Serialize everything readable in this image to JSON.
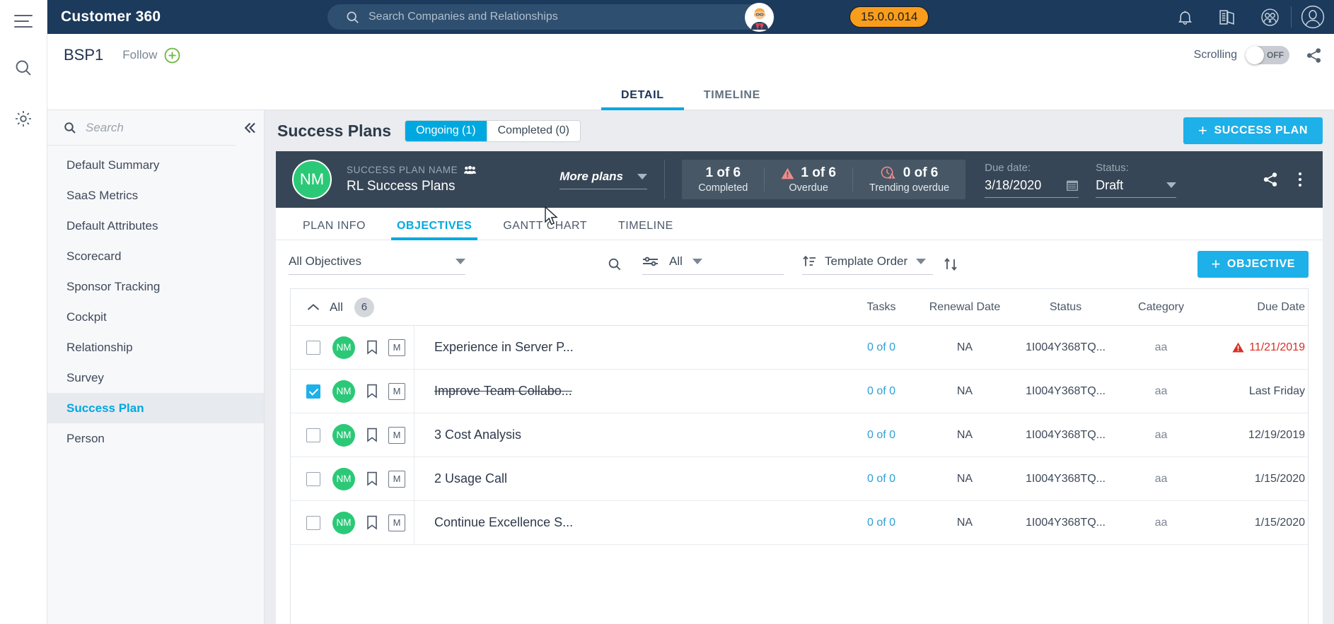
{
  "topbar": {
    "brand": "Customer 360",
    "search_placeholder": "Search Companies and Relationships",
    "version": "15.0.0.014",
    "icons": [
      "bell-icon",
      "book-icon",
      "people-icon",
      "user-avatar-icon"
    ]
  },
  "subheader": {
    "entity": "BSP1",
    "follow_label": "Follow",
    "scrolling_label": "Scrolling",
    "scrolling_state": "OFF"
  },
  "main_tabs": [
    {
      "label": "DETAIL",
      "active": true
    },
    {
      "label": "TIMELINE",
      "active": false
    }
  ],
  "leftnav": {
    "search_placeholder": "Search",
    "search_value": "",
    "items": [
      {
        "label": "Default Summary",
        "active": false
      },
      {
        "label": "SaaS Metrics",
        "active": false
      },
      {
        "label": "Default Attributes",
        "active": false
      },
      {
        "label": "Scorecard",
        "active": false
      },
      {
        "label": "Sponsor Tracking",
        "active": false
      },
      {
        "label": "Cockpit",
        "active": false
      },
      {
        "label": "Relationship",
        "active": false
      },
      {
        "label": "Survey",
        "active": false
      },
      {
        "label": "Success Plan",
        "active": true
      },
      {
        "label": "Person",
        "active": false
      }
    ]
  },
  "success_plans": {
    "title": "Success Plans",
    "segments": [
      {
        "label": "Ongoing (1)",
        "active": true
      },
      {
        "label": "Completed (0)",
        "active": false
      }
    ],
    "add_button": "SUCCESS PLAN"
  },
  "plan_card": {
    "avatar_initials": "NM",
    "name_label": "SUCCESS PLAN NAME",
    "name": "RL Success Plans",
    "more_plans": "More plans",
    "stats": [
      {
        "value": "1 of 6",
        "label": "Completed",
        "icon": null
      },
      {
        "value": "1 of 6",
        "label": "Overdue",
        "icon": "warning-triangle-icon"
      },
      {
        "value": "0 of 6",
        "label": "Trending overdue",
        "icon": "clock-warning-icon"
      }
    ],
    "due_date_label": "Due date:",
    "due_date_value": "3/18/2020",
    "status_label": "Status:",
    "status_value": "Draft"
  },
  "plan_tabs": [
    {
      "label": "PLAN INFO",
      "active": false
    },
    {
      "label": "OBJECTIVES",
      "active": true
    },
    {
      "label": "GANTT CHART",
      "active": false
    },
    {
      "label": "TIMELINE",
      "active": false
    }
  ],
  "objectives_toolbar": {
    "scope_select": "All Objectives",
    "filter_select": "All",
    "sort_select": "Template Order",
    "add_button": "OBJECTIVE"
  },
  "table": {
    "group_label": "All",
    "group_count": "6",
    "columns": [
      "Tasks",
      "Renewal Date",
      "Status",
      "Category",
      "Due Date"
    ],
    "rows": [
      {
        "checked": false,
        "avatar": "NM",
        "flag": "M",
        "name": "Experience in Server P...",
        "struck": false,
        "tasks": "0 of 0",
        "renewal": "NA",
        "status": "1I004Y368TQ...",
        "category": "aa",
        "due": "11/21/2019",
        "due_overdue": true
      },
      {
        "checked": true,
        "avatar": "NM",
        "flag": "M",
        "name": "Improve Team Collabo...",
        "struck": true,
        "tasks": "0 of 0",
        "renewal": "NA",
        "status": "1I004Y368TQ...",
        "category": "aa",
        "due": "Last Friday",
        "due_overdue": false
      },
      {
        "checked": false,
        "avatar": "NM",
        "flag": "M",
        "name": "3 Cost Analysis",
        "struck": false,
        "tasks": "0 of 0",
        "renewal": "NA",
        "status": "1I004Y368TQ...",
        "category": "aa",
        "due": "12/19/2019",
        "due_overdue": false
      },
      {
        "checked": false,
        "avatar": "NM",
        "flag": "M",
        "name": "2 Usage Call",
        "struck": false,
        "tasks": "0 of 0",
        "renewal": "NA",
        "status": "1I004Y368TQ...",
        "category": "aa",
        "due": "1/15/2020",
        "due_overdue": false
      },
      {
        "checked": false,
        "avatar": "NM",
        "flag": "M",
        "name": "Continue Excellence S...",
        "struck": false,
        "tasks": "0 of 0",
        "renewal": "NA",
        "status": "1I004Y368TQ...",
        "category": "aa",
        "due": "1/15/2020",
        "due_overdue": false
      }
    ]
  },
  "colors": {
    "navy": "#1b3a5c",
    "accent_blue": "#00a8e0",
    "orange": "#f99d1c",
    "green_avatar": "#2bc977",
    "card_dark": "#374656",
    "overdue_red": "#d93025"
  }
}
